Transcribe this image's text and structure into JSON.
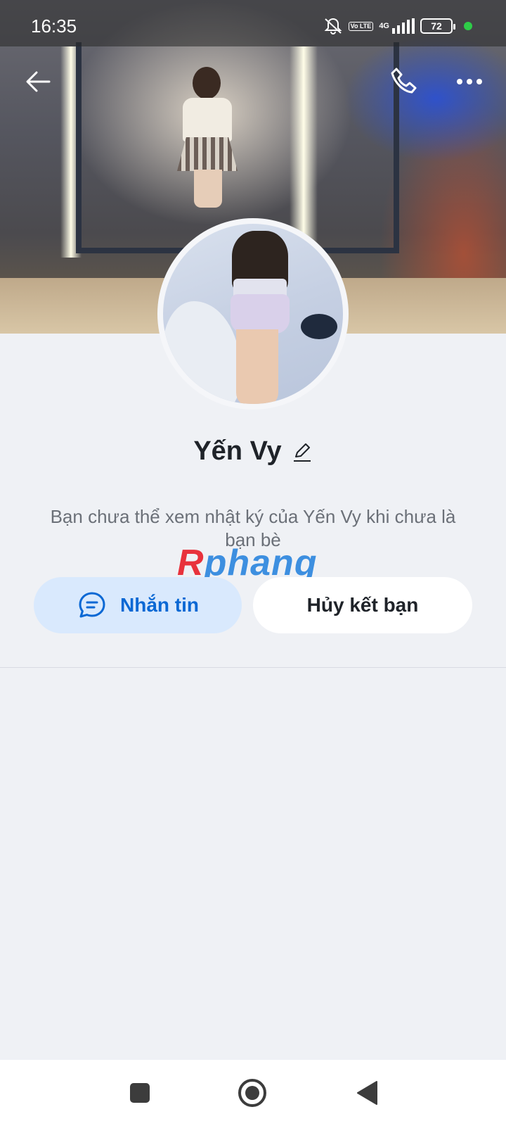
{
  "status_bar": {
    "time": "16:35",
    "network": "4G",
    "volte": "Vo LTE",
    "battery": "72",
    "indicator_color": "#2ecc48"
  },
  "header": {
    "back_icon": "arrow-left-icon",
    "call_icon": "phone-icon",
    "more_icon": "more-horizontal-icon"
  },
  "profile": {
    "name": "Yến Vy",
    "edit_icon": "pencil-icon",
    "notice": "Bạn chưa thể xem nhật ký của Yến Vy khi chưa là bạn bè"
  },
  "watermark": {
    "part_a": "R",
    "part_b": "phang"
  },
  "actions": {
    "message_label": "Nhắn tin",
    "message_icon": "chat-bubble-icon",
    "unfriend_label": "Hủy kết bạn"
  },
  "colors": {
    "accent": "#0a68d4",
    "accent_soft": "#d9e9fd",
    "background": "#eff1f5"
  },
  "nav_bar": {
    "recent_icon": "square-icon",
    "home_icon": "circle-icon",
    "back_icon": "triangle-back-icon"
  }
}
